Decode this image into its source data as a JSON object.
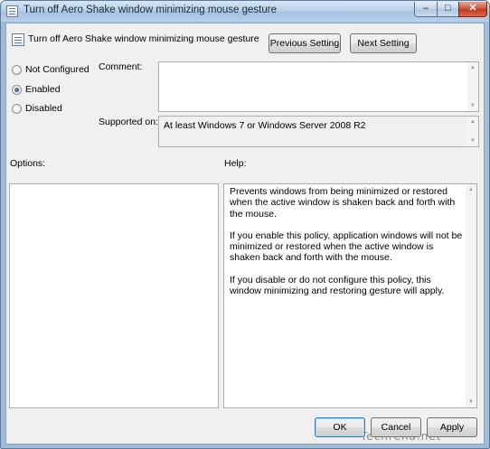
{
  "window": {
    "title": "Turn off Aero Shake window minimizing mouse gesture",
    "caption_buttons": {
      "minimize": "–",
      "maximize": "□",
      "close": "✕"
    }
  },
  "header": {
    "setting_title": "Turn off Aero Shake window minimizing mouse gesture",
    "previous_label": "Previous Setting",
    "next_label": "Next Setting"
  },
  "state": {
    "options": [
      {
        "label": "Not Configured",
        "checked": false
      },
      {
        "label": "Enabled",
        "checked": true
      },
      {
        "label": "Disabled",
        "checked": false
      }
    ]
  },
  "comment": {
    "label": "Comment:",
    "value": ""
  },
  "supported": {
    "label": "Supported on:",
    "value": "At least Windows 7 or Windows Server 2008 R2"
  },
  "options_label": "Options:",
  "help": {
    "label": "Help:",
    "paragraphs": [
      "Prevents windows from being minimized or restored when the active window is shaken back and forth with the mouse.",
      "If you enable this policy, application windows will not be minimized or restored when the active window is shaken back and forth with the mouse.",
      "If you disable or do not configure this policy, this window minimizing and restoring gesture will apply."
    ]
  },
  "footer": {
    "ok_label": "OK",
    "cancel_label": "Cancel",
    "apply_label": "Apply"
  },
  "watermark": "Techrena.net",
  "icons": {
    "scroll_up": "▲",
    "scroll_down": "▼"
  }
}
